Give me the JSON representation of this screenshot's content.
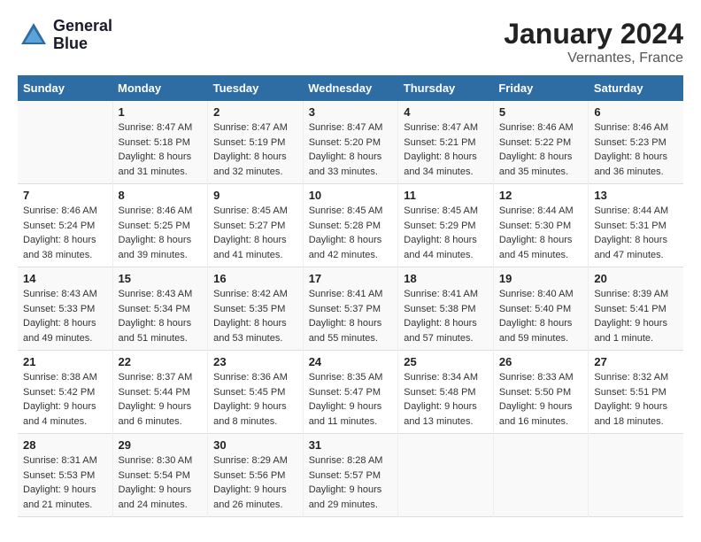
{
  "logo": {
    "line1": "General",
    "line2": "Blue"
  },
  "title": "January 2024",
  "subtitle": "Vernantes, France",
  "weekdays": [
    "Sunday",
    "Monday",
    "Tuesday",
    "Wednesday",
    "Thursday",
    "Friday",
    "Saturday"
  ],
  "weeks": [
    [
      {
        "day": "",
        "info": ""
      },
      {
        "day": "1",
        "info": "Sunrise: 8:47 AM\nSunset: 5:18 PM\nDaylight: 8 hours\nand 31 minutes."
      },
      {
        "day": "2",
        "info": "Sunrise: 8:47 AM\nSunset: 5:19 PM\nDaylight: 8 hours\nand 32 minutes."
      },
      {
        "day": "3",
        "info": "Sunrise: 8:47 AM\nSunset: 5:20 PM\nDaylight: 8 hours\nand 33 minutes."
      },
      {
        "day": "4",
        "info": "Sunrise: 8:47 AM\nSunset: 5:21 PM\nDaylight: 8 hours\nand 34 minutes."
      },
      {
        "day": "5",
        "info": "Sunrise: 8:46 AM\nSunset: 5:22 PM\nDaylight: 8 hours\nand 35 minutes."
      },
      {
        "day": "6",
        "info": "Sunrise: 8:46 AM\nSunset: 5:23 PM\nDaylight: 8 hours\nand 36 minutes."
      }
    ],
    [
      {
        "day": "7",
        "info": "Sunrise: 8:46 AM\nSunset: 5:24 PM\nDaylight: 8 hours\nand 38 minutes."
      },
      {
        "day": "8",
        "info": "Sunrise: 8:46 AM\nSunset: 5:25 PM\nDaylight: 8 hours\nand 39 minutes."
      },
      {
        "day": "9",
        "info": "Sunrise: 8:45 AM\nSunset: 5:27 PM\nDaylight: 8 hours\nand 41 minutes."
      },
      {
        "day": "10",
        "info": "Sunrise: 8:45 AM\nSunset: 5:28 PM\nDaylight: 8 hours\nand 42 minutes."
      },
      {
        "day": "11",
        "info": "Sunrise: 8:45 AM\nSunset: 5:29 PM\nDaylight: 8 hours\nand 44 minutes."
      },
      {
        "day": "12",
        "info": "Sunrise: 8:44 AM\nSunset: 5:30 PM\nDaylight: 8 hours\nand 45 minutes."
      },
      {
        "day": "13",
        "info": "Sunrise: 8:44 AM\nSunset: 5:31 PM\nDaylight: 8 hours\nand 47 minutes."
      }
    ],
    [
      {
        "day": "14",
        "info": "Sunrise: 8:43 AM\nSunset: 5:33 PM\nDaylight: 8 hours\nand 49 minutes."
      },
      {
        "day": "15",
        "info": "Sunrise: 8:43 AM\nSunset: 5:34 PM\nDaylight: 8 hours\nand 51 minutes."
      },
      {
        "day": "16",
        "info": "Sunrise: 8:42 AM\nSunset: 5:35 PM\nDaylight: 8 hours\nand 53 minutes."
      },
      {
        "day": "17",
        "info": "Sunrise: 8:41 AM\nSunset: 5:37 PM\nDaylight: 8 hours\nand 55 minutes."
      },
      {
        "day": "18",
        "info": "Sunrise: 8:41 AM\nSunset: 5:38 PM\nDaylight: 8 hours\nand 57 minutes."
      },
      {
        "day": "19",
        "info": "Sunrise: 8:40 AM\nSunset: 5:40 PM\nDaylight: 8 hours\nand 59 minutes."
      },
      {
        "day": "20",
        "info": "Sunrise: 8:39 AM\nSunset: 5:41 PM\nDaylight: 9 hours\nand 1 minute."
      }
    ],
    [
      {
        "day": "21",
        "info": "Sunrise: 8:38 AM\nSunset: 5:42 PM\nDaylight: 9 hours\nand 4 minutes."
      },
      {
        "day": "22",
        "info": "Sunrise: 8:37 AM\nSunset: 5:44 PM\nDaylight: 9 hours\nand 6 minutes."
      },
      {
        "day": "23",
        "info": "Sunrise: 8:36 AM\nSunset: 5:45 PM\nDaylight: 9 hours\nand 8 minutes."
      },
      {
        "day": "24",
        "info": "Sunrise: 8:35 AM\nSunset: 5:47 PM\nDaylight: 9 hours\nand 11 minutes."
      },
      {
        "day": "25",
        "info": "Sunrise: 8:34 AM\nSunset: 5:48 PM\nDaylight: 9 hours\nand 13 minutes."
      },
      {
        "day": "26",
        "info": "Sunrise: 8:33 AM\nSunset: 5:50 PM\nDaylight: 9 hours\nand 16 minutes."
      },
      {
        "day": "27",
        "info": "Sunrise: 8:32 AM\nSunset: 5:51 PM\nDaylight: 9 hours\nand 18 minutes."
      }
    ],
    [
      {
        "day": "28",
        "info": "Sunrise: 8:31 AM\nSunset: 5:53 PM\nDaylight: 9 hours\nand 21 minutes."
      },
      {
        "day": "29",
        "info": "Sunrise: 8:30 AM\nSunset: 5:54 PM\nDaylight: 9 hours\nand 24 minutes."
      },
      {
        "day": "30",
        "info": "Sunrise: 8:29 AM\nSunset: 5:56 PM\nDaylight: 9 hours\nand 26 minutes."
      },
      {
        "day": "31",
        "info": "Sunrise: 8:28 AM\nSunset: 5:57 PM\nDaylight: 9 hours\nand 29 minutes."
      },
      {
        "day": "",
        "info": ""
      },
      {
        "day": "",
        "info": ""
      },
      {
        "day": "",
        "info": ""
      }
    ]
  ]
}
